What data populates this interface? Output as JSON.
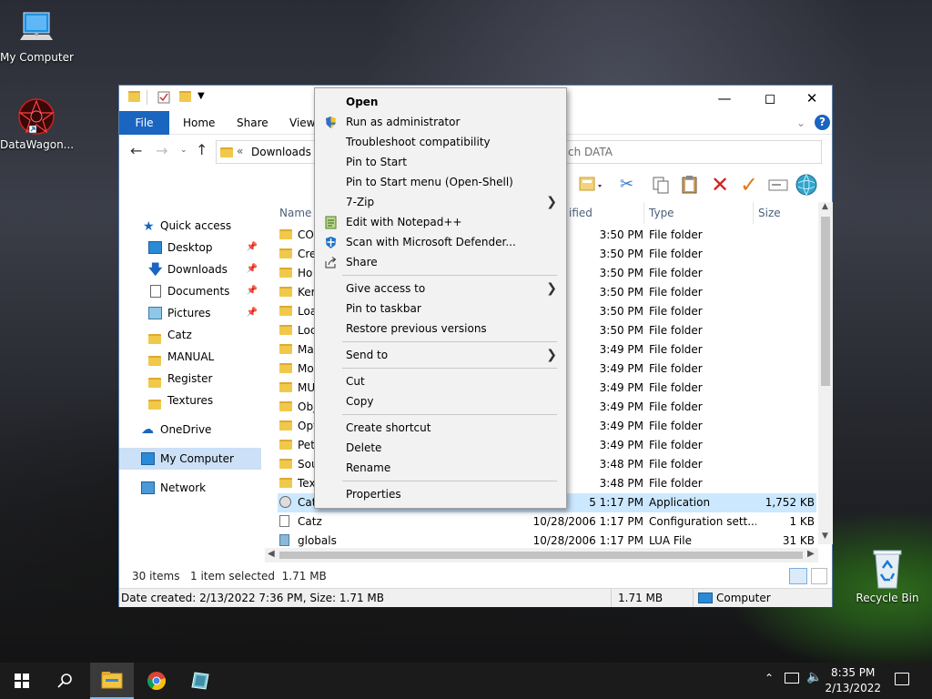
{
  "desktop": {
    "icons": [
      {
        "label": "My Computer"
      },
      {
        "label": "DataWagon..."
      },
      {
        "label": "Recycle Bin"
      }
    ]
  },
  "window": {
    "ribbon_tabs": [
      "File",
      "Home",
      "Share",
      "View"
    ],
    "address": {
      "prefix": "«",
      "location": "Downloads"
    },
    "search_placeholder": "ch DATA",
    "nav": {
      "quick_access": "Quick access",
      "items": [
        "Desktop",
        "Downloads",
        "Documents",
        "Pictures",
        "Catz",
        "MANUAL",
        "Register",
        "Textures"
      ],
      "onedrive": "OneDrive",
      "my_computer": "My Computer",
      "network": "Network"
    },
    "columns": {
      "name": "Name",
      "modified": "ified",
      "type": "Type",
      "size": "Size"
    },
    "rows": [
      {
        "name": "CO",
        "date": "3:50 PM",
        "type": "File folder",
        "size": ""
      },
      {
        "name": "Cre",
        "date": "3:50 PM",
        "type": "File folder",
        "size": ""
      },
      {
        "name": "Ho",
        "date": "3:50 PM",
        "type": "File folder",
        "size": ""
      },
      {
        "name": "Ker",
        "date": "3:50 PM",
        "type": "File folder",
        "size": ""
      },
      {
        "name": "Loa",
        "date": "3:50 PM",
        "type": "File folder",
        "size": ""
      },
      {
        "name": "Loc",
        "date": "3:50 PM",
        "type": "File folder",
        "size": ""
      },
      {
        "name": "Ma",
        "date": "3:49 PM",
        "type": "File folder",
        "size": ""
      },
      {
        "name": "Mo",
        "date": "3:49 PM",
        "type": "File folder",
        "size": ""
      },
      {
        "name": "MU",
        "date": "3:49 PM",
        "type": "File folder",
        "size": ""
      },
      {
        "name": "Obj",
        "date": "3:49 PM",
        "type": "File folder",
        "size": ""
      },
      {
        "name": "Opt",
        "date": "3:49 PM",
        "type": "File folder",
        "size": ""
      },
      {
        "name": "Pet",
        "date": "3:49 PM",
        "type": "File folder",
        "size": ""
      },
      {
        "name": "Sou",
        "date": "3:48 PM",
        "type": "File folder",
        "size": ""
      },
      {
        "name": "Tex",
        "date": "3:48 PM",
        "type": "File folder",
        "size": ""
      },
      {
        "name": "Cat",
        "date": "5 1:17 PM",
        "type": "Application",
        "size": "1,752 KB"
      },
      {
        "name": "Catz",
        "date": "10/28/2006 1:17 PM",
        "type": "Configuration sett...",
        "size": "1 KB"
      },
      {
        "name": "globals",
        "date": "10/28/2006 1:17 PM",
        "type": "LUA File",
        "size": "31 KB"
      }
    ],
    "status": {
      "items": "30 items",
      "selected": "1 item selected  1.71 MB"
    },
    "details": {
      "created": "Date created: 2/13/2022 7:36 PM, Size: 1.71 MB",
      "size": "1.71 MB",
      "location": "Computer"
    }
  },
  "context_menu": {
    "groups": [
      [
        {
          "label": "Open",
          "bold": true
        },
        {
          "label": "Run as administrator",
          "icon": "shield-icon"
        },
        {
          "label": "Troubleshoot compatibility"
        },
        {
          "label": "Pin to Start"
        },
        {
          "label": "Pin to Start menu (Open-Shell)"
        },
        {
          "label": "7-Zip",
          "submenu": true
        },
        {
          "label": "Edit with Notepad++",
          "icon": "notepad-icon"
        },
        {
          "label": "Scan with Microsoft Defender...",
          "icon": "defender-icon"
        },
        {
          "label": "Share",
          "icon": "share-icon"
        }
      ],
      [
        {
          "label": "Give access to",
          "submenu": true
        },
        {
          "label": "Pin to taskbar"
        },
        {
          "label": "Restore previous versions"
        }
      ],
      [
        {
          "label": "Send to",
          "submenu": true
        }
      ],
      [
        {
          "label": "Cut"
        },
        {
          "label": "Copy"
        }
      ],
      [
        {
          "label": "Create shortcut"
        },
        {
          "label": "Delete"
        },
        {
          "label": "Rename"
        }
      ],
      [
        {
          "label": "Properties"
        }
      ]
    ]
  },
  "taskbar": {
    "time": "8:35 PM",
    "date": "2/13/2022"
  }
}
